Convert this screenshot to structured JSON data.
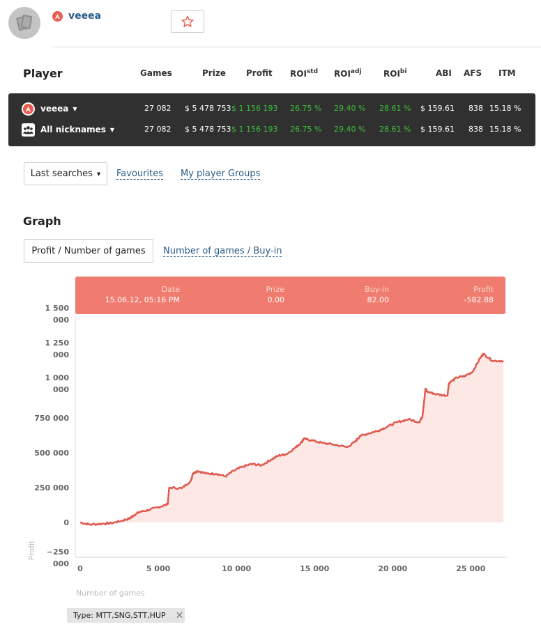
{
  "header": {
    "nickname": "veeea"
  },
  "player_table": {
    "title": "Player",
    "columns": {
      "games": "Games",
      "prize": "Prize",
      "profit": "Profit",
      "roi_std": "ROI",
      "roi_std_sup": "std",
      "roi_adj": "ROI",
      "roi_adj_sup": "adj",
      "roi_bi": "ROI",
      "roi_bi_sup": "bi",
      "abi": "ABI",
      "afs": "AFS",
      "itm": "ITM"
    },
    "rows": [
      {
        "name": "veeea",
        "games": "27 082",
        "prize": "$ 5 478 753",
        "profit": "$ 1 156 193",
        "roi_std": "26.75 %",
        "roi_adj": "29.40 %",
        "roi_bi": "28.61 %",
        "abi": "$ 159.61",
        "afs": "838",
        "itm": "15.18 %"
      },
      {
        "name": "All nicknames",
        "games": "27 082",
        "prize": "$ 5 478 753",
        "profit": "$ 1 156 193",
        "roi_std": "26.75 %",
        "roi_adj": "29.40 %",
        "roi_bi": "28.61 %",
        "abi": "$ 159.61",
        "afs": "838",
        "itm": "15.18 %"
      }
    ]
  },
  "controls": {
    "last_searches": "Last searches",
    "favourites": "Favourites",
    "my_player_groups": "My player Groups"
  },
  "graph": {
    "title": "Graph",
    "tab_active": "Profit / Number of games",
    "tab_other": "Number of games / Buy-in",
    "tooltip": {
      "date_label": "Date",
      "date_value": "15.06.12, 05:16 PM",
      "prize_label": "Prize",
      "prize_value": "0.00",
      "buyin_label": "Buy-in",
      "buyin_value": "82.00",
      "profit_label": "Profit",
      "profit_value": "-582.88"
    },
    "filter_chip": "Type: MTT,SNG,STT,HUP"
  },
  "colors": {
    "line": "#e05a4e",
    "area": "#fde8e6",
    "brand": "#e85d4f",
    "positive": "#3fbf3a"
  },
  "chart_data": {
    "type": "area",
    "xlabel": "Number of games",
    "ylabel": "Profit",
    "xlim": [
      0,
      27082
    ],
    "ylim": [
      -250000,
      1500000
    ],
    "x_ticks": [
      0,
      5000,
      10000,
      15000,
      20000,
      25000
    ],
    "x_tick_labels": [
      "0",
      "5 000",
      "10 000",
      "15 000",
      "20 000",
      "25 000"
    ],
    "y_ticks": [
      1500000,
      1250000,
      1000000,
      750000,
      500000,
      250000,
      0,
      -250000
    ],
    "y_tick_labels": [
      [
        "1 500",
        "000"
      ],
      [
        "1 250",
        "000"
      ],
      [
        "1 000",
        "000"
      ],
      [
        "750 000"
      ],
      [
        "500 000"
      ],
      [
        "250 000"
      ],
      [
        "0"
      ],
      [
        "−250",
        "000"
      ]
    ],
    "series": [
      {
        "x": [
          0,
          600,
          1400,
          2000,
          2600,
          3200,
          3400,
          3800,
          4400,
          5000,
          5600,
          5700,
          6500,
          7100,
          7200,
          7500,
          8100,
          8700,
          9300,
          9800,
          10400,
          11000,
          11600,
          12200,
          12700,
          13200,
          13800,
          14200,
          14300,
          14800,
          15500,
          16200,
          17100,
          17600,
          17900,
          18500,
          19100,
          19700,
          20300,
          21000,
          21700,
          21900,
          22100,
          22200,
          22800,
          23500,
          23600,
          24100,
          24600,
          25100,
          25600,
          25800,
          26400,
          27082
        ],
        "y": [
          0,
          -15000,
          -10000,
          -5000,
          10000,
          30000,
          50000,
          75000,
          90000,
          110000,
          130000,
          250000,
          245000,
          300000,
          350000,
          370000,
          350000,
          350000,
          330000,
          370000,
          400000,
          420000,
          410000,
          450000,
          480000,
          490000,
          540000,
          580000,
          600000,
          590000,
          570000,
          560000,
          540000,
          580000,
          620000,
          640000,
          660000,
          690000,
          720000,
          740000,
          720000,
          760000,
          960000,
          940000,
          920000,
          910000,
          1000000,
          1040000,
          1050000,
          1080000,
          1180000,
          1210000,
          1160000,
          1160000
        ]
      }
    ]
  }
}
